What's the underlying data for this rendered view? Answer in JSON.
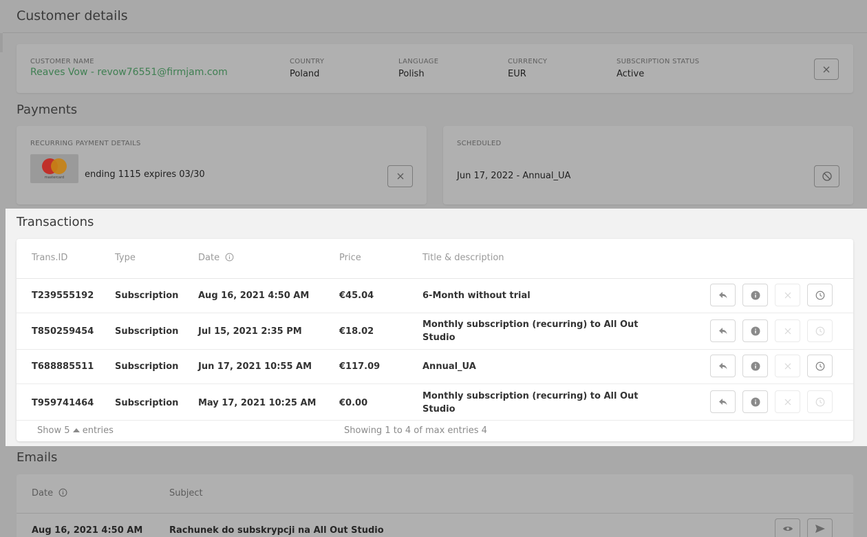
{
  "customer_details": {
    "title": "Customer details",
    "fields": {
      "customer_name": {
        "label": "CUSTOMER NAME",
        "value": "Reaves Vow - revow76551@firmjam.com"
      },
      "country": {
        "label": "COUNTRY",
        "value": "Poland"
      },
      "language": {
        "label": "LANGUAGE",
        "value": "Polish"
      },
      "currency": {
        "label": "CURRENCY",
        "value": "EUR"
      },
      "subscription_status": {
        "label": "SUBSCRIPTION STATUS",
        "value": "Active"
      }
    },
    "close_icon": "close-icon"
  },
  "payments": {
    "title": "Payments",
    "recurring": {
      "label": "RECURRING PAYMENT DETAILS",
      "card_brand": "mastercard",
      "card_text": "ending 1115 expires 03/30",
      "remove_icon": "close-icon"
    },
    "scheduled": {
      "label": "SCHEDULED",
      "date": "Jun 17, 2022",
      "separator": " - ",
      "plan": "Annual_UA",
      "cancel_icon": "block-icon"
    }
  },
  "transactions": {
    "title": "Transactions",
    "columns": [
      "Trans.ID",
      "Type",
      "Date",
      "Price",
      "Title & description"
    ],
    "date_info_icon": "info-circle-icon",
    "rows": [
      {
        "id": "T239555192",
        "type": "Subscription",
        "date": "Aug 16, 2021 4:50 AM",
        "price": "€45.04",
        "title": "6-Month without trial",
        "title_line2": "",
        "cancel_enabled": false,
        "schedule_enabled": true
      },
      {
        "id": "T850259454",
        "type": "Subscription",
        "date": "Jul 15, 2021 2:35 PM",
        "price": "€18.02",
        "title": "Monthly subscription (recurring) to All Out",
        "title_line2": "Studio",
        "cancel_enabled": false,
        "schedule_enabled": false
      },
      {
        "id": "T688885511",
        "type": "Subscription",
        "date": "Jun 17, 2021 10:55 AM",
        "price": "€117.09",
        "title": "Annual_UA",
        "title_line2": "",
        "cancel_enabled": false,
        "schedule_enabled": true
      },
      {
        "id": "T959741464",
        "type": "Subscription",
        "date": "May 17, 2021 10:25 AM",
        "price": "€0.00",
        "title": "Monthly subscription (recurring) to All Out",
        "title_line2": "Studio",
        "cancel_enabled": false,
        "schedule_enabled": false
      }
    ],
    "footer": {
      "show": "Show",
      "page_size": "5",
      "entries": "entries",
      "summary": "Showing 1 to 4 of max entries 4"
    },
    "row_action_icons": [
      "reply-icon",
      "info-icon",
      "close-icon",
      "clock-icon"
    ]
  },
  "emails": {
    "title": "Emails",
    "columns": [
      "Date",
      "Subject"
    ],
    "rows": [
      {
        "date": "Aug 16, 2021 4:50 AM",
        "subject": "Rachunek do subskrypcji na All Out Studio"
      }
    ],
    "row_action_icons": [
      "eye-icon",
      "send-icon"
    ]
  },
  "colors": {
    "overlay_bg": "#a9a9a9",
    "highlight_bg": "#f2f2f2",
    "name_green": "#3f7f52",
    "mastercard_red": "#c0302a",
    "mastercard_orange": "#c78216"
  }
}
